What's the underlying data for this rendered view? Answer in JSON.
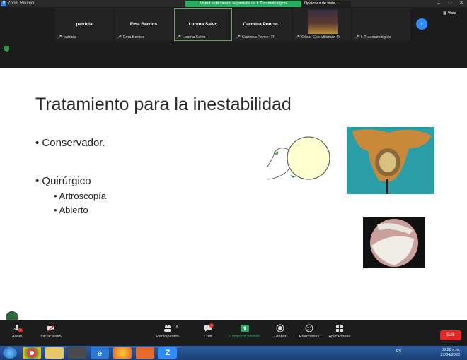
{
  "window": {
    "title": "Zoom Reunión"
  },
  "banner": {
    "share_text": "Usted está viendo la pantalla de I. Traumatológico",
    "view_options": "Opciones de vista ⌄"
  },
  "vista_label": "Vista",
  "participants": [
    {
      "big": "patricia",
      "small": "patricia"
    },
    {
      "big": "Ema Berrios",
      "small": "Ema Berrios"
    },
    {
      "big": "Lorena Salvo",
      "small": "Lorena Salvo"
    },
    {
      "big": "Carmina Ponce-...",
      "small": "Carmina Ponce- IT"
    },
    {
      "big": "",
      "small": "César Ces Villamán R"
    },
    {
      "big": "",
      "small": "I. Traumatológico"
    }
  ],
  "slide": {
    "title": "Tratamiento para la inestabilidad",
    "bullet1": "• Conservador.",
    "bullet2": "• Quirúrgico",
    "sub1": "• Artroscopía",
    "sub2": "• Abierto"
  },
  "toolbar": {
    "audio": "Audio",
    "video": "Iniciar video",
    "participants": "Participantes",
    "participants_count": "18",
    "chat": "Chat",
    "chat_badge": "4",
    "share": "Compartir pantalla",
    "record": "Grabar",
    "reactions": "Reacciones",
    "apps": "Aplicaciones",
    "leave": "Salir"
  },
  "taskbar": {
    "lang": "ES",
    "time": "09:28 a.m.",
    "date": "27/04/2023"
  },
  "colors": {
    "accent": "#2d8cff",
    "share_green": "#27ae60",
    "leave_red": "#e02828"
  }
}
